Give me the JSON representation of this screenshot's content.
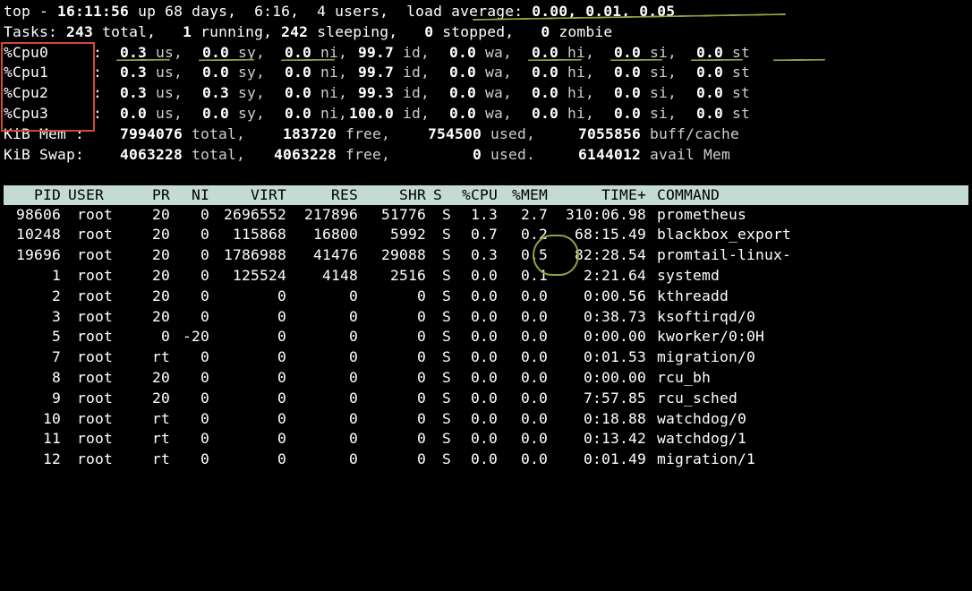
{
  "header": {
    "program": "top",
    "time": "16:11:56",
    "uptime": "up 68 days,  6:16",
    "users": "4 users",
    "load_label": "load average:",
    "load": "0.00, 0.01, 0.05"
  },
  "tasks": {
    "label": "Tasks:",
    "total": "243",
    "total_l": "total,",
    "running": "1",
    "running_l": "running,",
    "sleeping": "242",
    "sleeping_l": "sleeping,",
    "stopped": "0",
    "stopped_l": "stopped,",
    "zombie": "0",
    "zombie_l": "zombie"
  },
  "cpu_cols": {
    "us": "us,",
    "sy": "sy,",
    "ni": "ni,",
    "id": "id,",
    "wa": "wa,",
    "hi": "hi,",
    "si": "si,",
    "st": "st"
  },
  "cpus": [
    {
      "name": "%Cpu0",
      "us": "0.3",
      "sy": "0.0",
      "ni": "0.0",
      "id": "99.7",
      "wa": "0.0",
      "hi": "0.0",
      "si": "0.0",
      "st": "0.0"
    },
    {
      "name": "%Cpu1",
      "us": "0.3",
      "sy": "0.0",
      "ni": "0.0",
      "id": "99.7",
      "wa": "0.0",
      "hi": "0.0",
      "si": "0.0",
      "st": "0.0"
    },
    {
      "name": "%Cpu2",
      "us": "0.3",
      "sy": "0.3",
      "ni": "0.0",
      "id": "99.3",
      "wa": "0.0",
      "hi": "0.0",
      "si": "0.0",
      "st": "0.0"
    },
    {
      "name": "%Cpu3",
      "us": "0.0",
      "sy": "0.0",
      "ni": "0.0",
      "id": "100.0",
      "wa": "0.0",
      "hi": "0.0",
      "si": "0.0",
      "st": "0.0"
    }
  ],
  "mem": {
    "label": "KiB Mem :",
    "total": "7994076",
    "total_l": "total,",
    "free": "183720",
    "free_l": "free,",
    "used": "754500",
    "used_l": "used,",
    "extra": "7055856",
    "extra_l": "buff/cache"
  },
  "swap": {
    "label": "KiB Swap:",
    "total": "4063228",
    "total_l": "total,",
    "free": "4063228",
    "free_l": "free,",
    "used": "0",
    "used_l": "used.",
    "extra": "6144012",
    "extra_l": "avail Mem"
  },
  "columns": {
    "pid": "PID",
    "user": "USER",
    "pr": "PR",
    "ni": "NI",
    "virt": "VIRT",
    "res": "RES",
    "shr": "SHR",
    "s": "S",
    "cpu": "%CPU",
    "mem": "%MEM",
    "time": "TIME+",
    "cmd": "COMMAND"
  },
  "procs": [
    {
      "pid": "98606",
      "user": "root",
      "pr": "20",
      "ni": "0",
      "virt": "2696552",
      "res": "217896",
      "shr": "51776",
      "s": "S",
      "cpu": "1.3",
      "mem": "2.7",
      "time": "310:06.98",
      "cmd": "prometheus"
    },
    {
      "pid": "10248",
      "user": "root",
      "pr": "20",
      "ni": "0",
      "virt": "115868",
      "res": "16800",
      "shr": "5992",
      "s": "S",
      "cpu": "0.7",
      "mem": "0.2",
      "time": "68:15.49",
      "cmd": "blackbox_export"
    },
    {
      "pid": "19696",
      "user": "root",
      "pr": "20",
      "ni": "0",
      "virt": "1786988",
      "res": "41476",
      "shr": "29088",
      "s": "S",
      "cpu": "0.3",
      "mem": "0.5",
      "time": "82:28.54",
      "cmd": "promtail-linux-"
    },
    {
      "pid": "1",
      "user": "root",
      "pr": "20",
      "ni": "0",
      "virt": "125524",
      "res": "4148",
      "shr": "2516",
      "s": "S",
      "cpu": "0.0",
      "mem": "0.1",
      "time": "2:21.64",
      "cmd": "systemd"
    },
    {
      "pid": "2",
      "user": "root",
      "pr": "20",
      "ni": "0",
      "virt": "0",
      "res": "0",
      "shr": "0",
      "s": "S",
      "cpu": "0.0",
      "mem": "0.0",
      "time": "0:00.56",
      "cmd": "kthreadd"
    },
    {
      "pid": "3",
      "user": "root",
      "pr": "20",
      "ni": "0",
      "virt": "0",
      "res": "0",
      "shr": "0",
      "s": "S",
      "cpu": "0.0",
      "mem": "0.0",
      "time": "0:38.73",
      "cmd": "ksoftirqd/0"
    },
    {
      "pid": "5",
      "user": "root",
      "pr": "0",
      "ni": "-20",
      "virt": "0",
      "res": "0",
      "shr": "0",
      "s": "S",
      "cpu": "0.0",
      "mem": "0.0",
      "time": "0:00.00",
      "cmd": "kworker/0:0H"
    },
    {
      "pid": "7",
      "user": "root",
      "pr": "rt",
      "ni": "0",
      "virt": "0",
      "res": "0",
      "shr": "0",
      "s": "S",
      "cpu": "0.0",
      "mem": "0.0",
      "time": "0:01.53",
      "cmd": "migration/0"
    },
    {
      "pid": "8",
      "user": "root",
      "pr": "20",
      "ni": "0",
      "virt": "0",
      "res": "0",
      "shr": "0",
      "s": "S",
      "cpu": "0.0",
      "mem": "0.0",
      "time": "0:00.00",
      "cmd": "rcu_bh"
    },
    {
      "pid": "9",
      "user": "root",
      "pr": "20",
      "ni": "0",
      "virt": "0",
      "res": "0",
      "shr": "0",
      "s": "S",
      "cpu": "0.0",
      "mem": "0.0",
      "time": "7:57.85",
      "cmd": "rcu_sched"
    },
    {
      "pid": "10",
      "user": "root",
      "pr": "rt",
      "ni": "0",
      "virt": "0",
      "res": "0",
      "shr": "0",
      "s": "S",
      "cpu": "0.0",
      "mem": "0.0",
      "time": "0:18.88",
      "cmd": "watchdog/0"
    },
    {
      "pid": "11",
      "user": "root",
      "pr": "rt",
      "ni": "0",
      "virt": "0",
      "res": "0",
      "shr": "0",
      "s": "S",
      "cpu": "0.0",
      "mem": "0.0",
      "time": "0:13.42",
      "cmd": "watchdog/1"
    },
    {
      "pid": "12",
      "user": "root",
      "pr": "rt",
      "ni": "0",
      "virt": "0",
      "res": "0",
      "shr": "0",
      "s": "S",
      "cpu": "0.0",
      "mem": "0.0",
      "time": "0:01.49",
      "cmd": "migration/1"
    }
  ],
  "annotation_colors": {
    "box": "#d44a2f",
    "stroke": "#8aa53f"
  }
}
